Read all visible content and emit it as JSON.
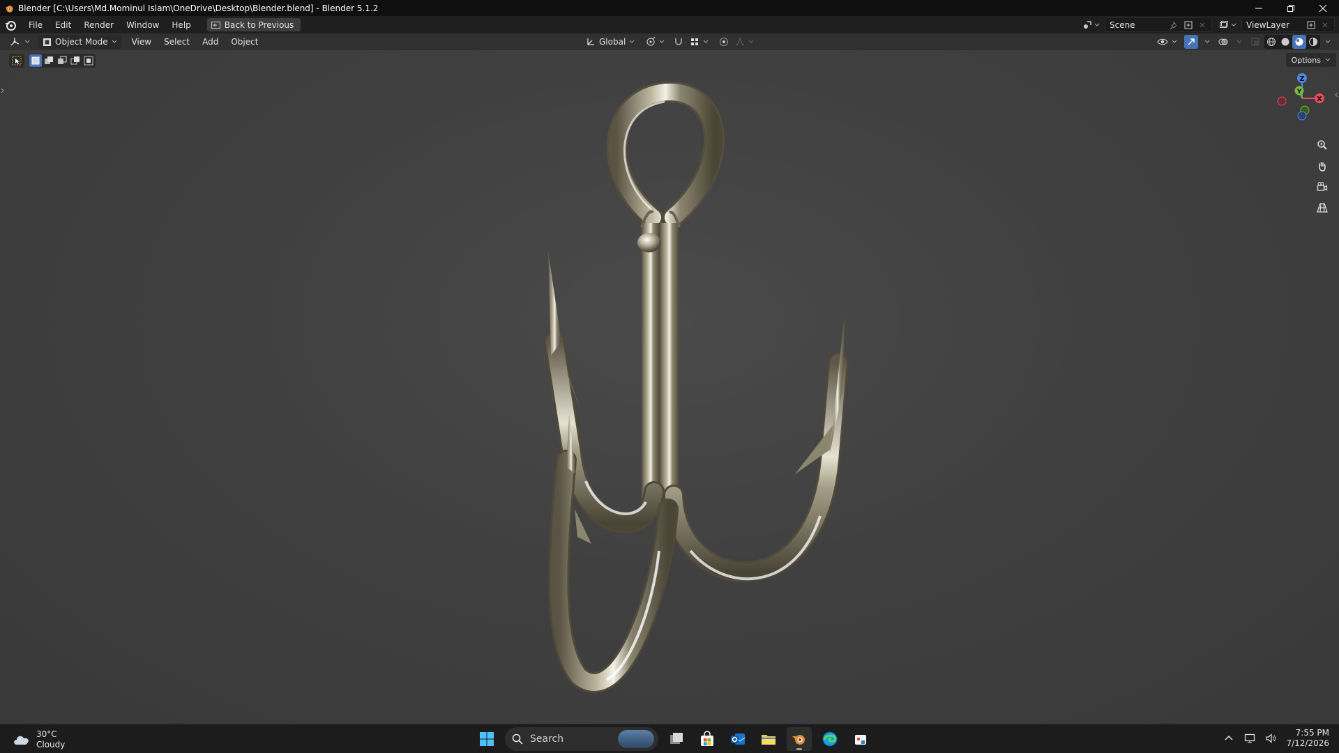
{
  "window": {
    "title": "Blender [C:\\Users\\Md.Mominul Islam\\OneDrive\\Desktop\\Blender.blend] - Blender 5.1.2"
  },
  "menu": {
    "items": [
      "File",
      "Edit",
      "Render",
      "Window",
      "Help"
    ],
    "back_button": "Back to Previous"
  },
  "scene": {
    "name": "Scene"
  },
  "view_layer": {
    "name": "ViewLayer"
  },
  "viewport_header": {
    "mode": "Object Mode",
    "menus": [
      "View",
      "Select",
      "Add",
      "Object"
    ],
    "orientation": "Global"
  },
  "viewport": {
    "options_label": "Options",
    "gizmo_axes": {
      "x": "X",
      "y": "Y",
      "z": "Z"
    },
    "accent": "#4772b3"
  },
  "taskbar": {
    "weather_temp": "30°C",
    "weather_desc": "Cloudy",
    "search_placeholder": "Search",
    "time": "7:55 PM",
    "date": "7/12/2026"
  }
}
